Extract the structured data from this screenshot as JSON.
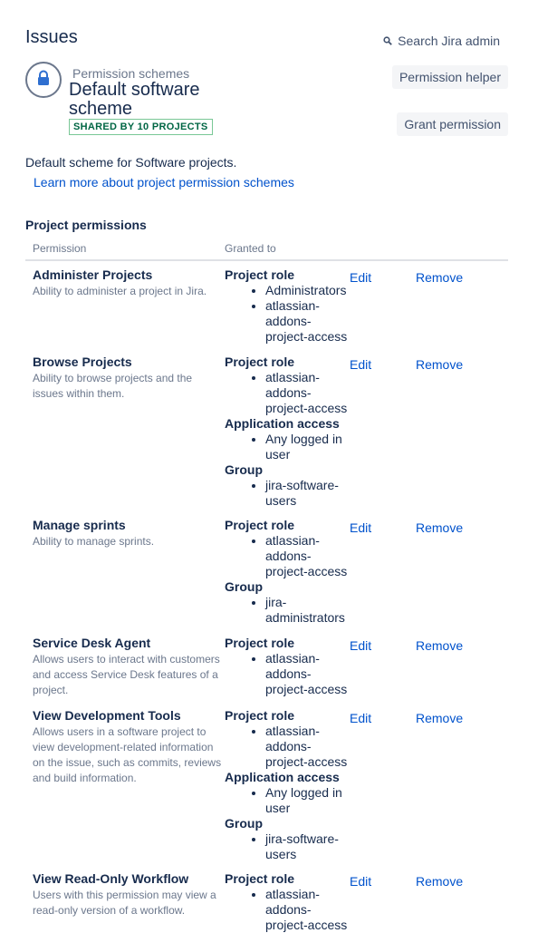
{
  "header": {
    "title": "Issues",
    "search_label": "Search Jira admin",
    "breadcrumb": "Permission schemes",
    "scheme_name": "Default software scheme",
    "badge": "SHARED BY 10 PROJECTS",
    "permission_helper": "Permission helper",
    "grant_permission": "Grant permission"
  },
  "intro": {
    "description": "Default scheme for Software projects.",
    "learn_more": "Learn more about project permission schemes"
  },
  "table": {
    "section_title": "Project permissions",
    "col_permission": "Permission",
    "col_granted": "Granted to",
    "edit_label": "Edit",
    "remove_label": "Remove",
    "rows": [
      {
        "name": "Administer Projects",
        "description": "Ability to administer a project in Jira.",
        "grants": [
          {
            "title": "Project role",
            "items": [
              "Administrators",
              "atlassian-addons-project-access"
            ]
          }
        ]
      },
      {
        "name": "Browse Projects",
        "description": "Ability to browse projects and the issues within them.",
        "grants": [
          {
            "title": "Project role",
            "items": [
              "atlassian-addons-project-access"
            ]
          },
          {
            "title": "Application access",
            "items": [
              "Any logged in user"
            ]
          },
          {
            "title": "Group",
            "items": [
              "jira-software-users"
            ]
          }
        ]
      },
      {
        "name": "Manage sprints",
        "description": "Ability to manage sprints.",
        "grants": [
          {
            "title": "Project role",
            "items": [
              "atlassian-addons-project-access"
            ]
          },
          {
            "title": "Group",
            "items": [
              "jira-administrators"
            ]
          }
        ]
      },
      {
        "name": "Service Desk Agent",
        "description": "Allows users to interact with customers and access Service Desk features of a project.",
        "grants": [
          {
            "title": "Project role",
            "items": [
              "atlassian-addons-project-access"
            ]
          }
        ]
      },
      {
        "name": "View Development Tools",
        "description": "Allows users in a software project to view development-related information on the issue, such as commits, reviews and build information.",
        "grants": [
          {
            "title": "Project role",
            "items": [
              "atlassian-addons-project-access"
            ]
          },
          {
            "title": "Application access",
            "items": [
              "Any logged in user"
            ]
          },
          {
            "title": "Group",
            "items": [
              "jira-software-users"
            ]
          }
        ]
      },
      {
        "name": "View Read-Only Workflow",
        "description": "Users with this permission may view a read-only version of a workflow.",
        "grants": [
          {
            "title": "Project role",
            "items": [
              "atlassian-addons-project-access"
            ]
          }
        ]
      }
    ]
  },
  "icons": {
    "lock": "lock-icon",
    "search": "search-icon"
  },
  "colors": {
    "link": "#0052cc",
    "text": "#172b4d",
    "subtle": "#6b778c",
    "badge_text": "#006644",
    "badge_border": "#79c796"
  }
}
